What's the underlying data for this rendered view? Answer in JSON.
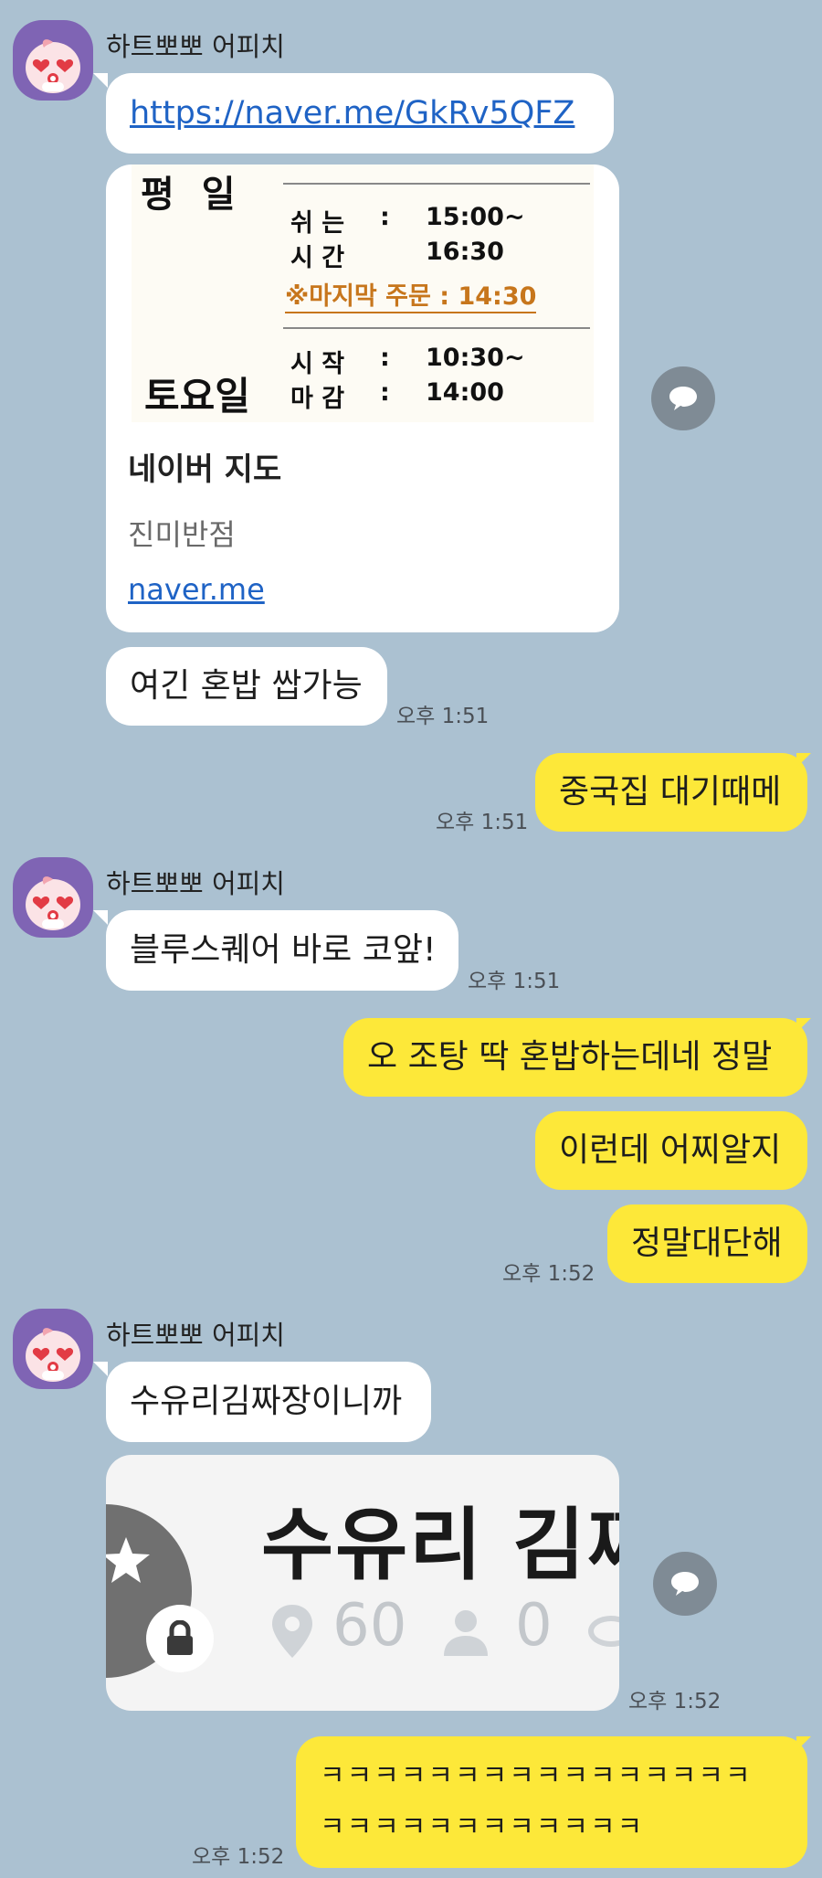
{
  "chat": {
    "sender_name": "하트뽀뽀 어피치",
    "msg_link_url": "https://naver.me/GkRv5QFZ",
    "preview1": {
      "weekday_label": "평   일",
      "rest_label1": "쉬 는",
      "rest_label2": "시 간",
      "colon": ":",
      "rest_time1": "15:00~",
      "rest_time2": "16:30",
      "last_order": "※마지막 주문 : 14:30",
      "saturday_label": "토요일",
      "start_label": "시 작",
      "end_label": "마 감",
      "start_time": "10:30~",
      "end_time": "14:00",
      "title": "네이버 지도",
      "subtitle": "진미반점",
      "domain": "naver.me"
    },
    "msg_solo": "여긴 혼밥 쌉가능",
    "time_151": "오후 1:51",
    "msg_wait": "중국집 대기때메",
    "msg_bluesquare": "블루스퀘어 바로 코앞!",
    "msg_jotang": "오 조탕 딱 혼밥하는데네 정말",
    "msg_how": "이런데 어찌알지",
    "msg_amazing": "정말대단해",
    "time_152": "오후 1:52",
    "msg_suyuri": "수유리김짜장이니까",
    "preview2": {
      "title": "수유리 김찌",
      "members": "60",
      "online": "0"
    },
    "msg_laugh_line1": "ㅋㅋㅋㅋㅋㅋㅋㅋㅋㅋㅋㅋㅋㅋㅋㅋ",
    "msg_laugh_line2": "ㅋㅋㅋㅋㅋㅋㅋㅋㅋㅋㅋㅋ"
  },
  "colors": {
    "background": "#abc1d1",
    "incoming_bubble": "#ffffff",
    "outgoing_bubble": "#fde839",
    "avatar": "#7f64b4",
    "share_button": "#7f8b95",
    "link": "#1f63c5",
    "last_order_text": "#c7761c"
  },
  "icons": {
    "avatar": "apeach-heart-eyes-icon",
    "share": "speech-bubble-icon",
    "pin": "location-pin-icon",
    "person": "person-icon",
    "lock": "lock-icon",
    "star": "star-icon"
  }
}
